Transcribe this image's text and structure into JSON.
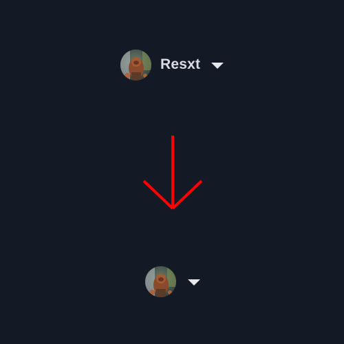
{
  "user_menu_expanded": {
    "username": "Resxt",
    "avatar_icon": "avatar-photo-icon",
    "caret_icon": "caret-down-icon"
  },
  "transition": {
    "icon": "arrow-down-icon",
    "color": "#ff0000"
  },
  "user_menu_collapsed": {
    "avatar_icon": "avatar-photo-icon",
    "caret_icon": "caret-down-icon"
  },
  "colors": {
    "background": "#131a26",
    "username_text": "#d9dde2",
    "caret": "#e6e8ec"
  }
}
